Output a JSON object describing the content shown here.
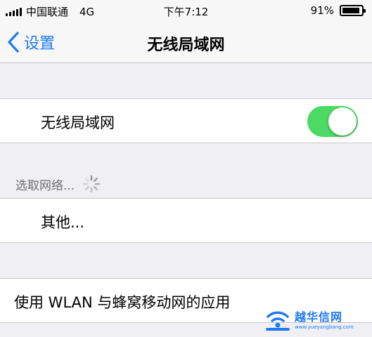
{
  "status_bar": {
    "carrier": "中国联通",
    "network": "4G",
    "time": "下午7:12",
    "battery_percent": "91%",
    "battery_level": 0.91
  },
  "nav": {
    "back_label": "设置",
    "title": "无线局域网"
  },
  "wifi_cell": {
    "label": "无线局域网",
    "toggle_on": true,
    "toggle_color": "#4cd964"
  },
  "networks_section": {
    "header": "选取网络..."
  },
  "other_cell": {
    "label": "其他..."
  },
  "wlan_cell": {
    "label": "使用 WLAN 与蜂窝移动网的应用"
  },
  "watermark": {
    "name": "越华信网",
    "url": "www.yueyangbang.com"
  },
  "colors": {
    "accent": "#1f7af5",
    "background": "#efeff4"
  }
}
